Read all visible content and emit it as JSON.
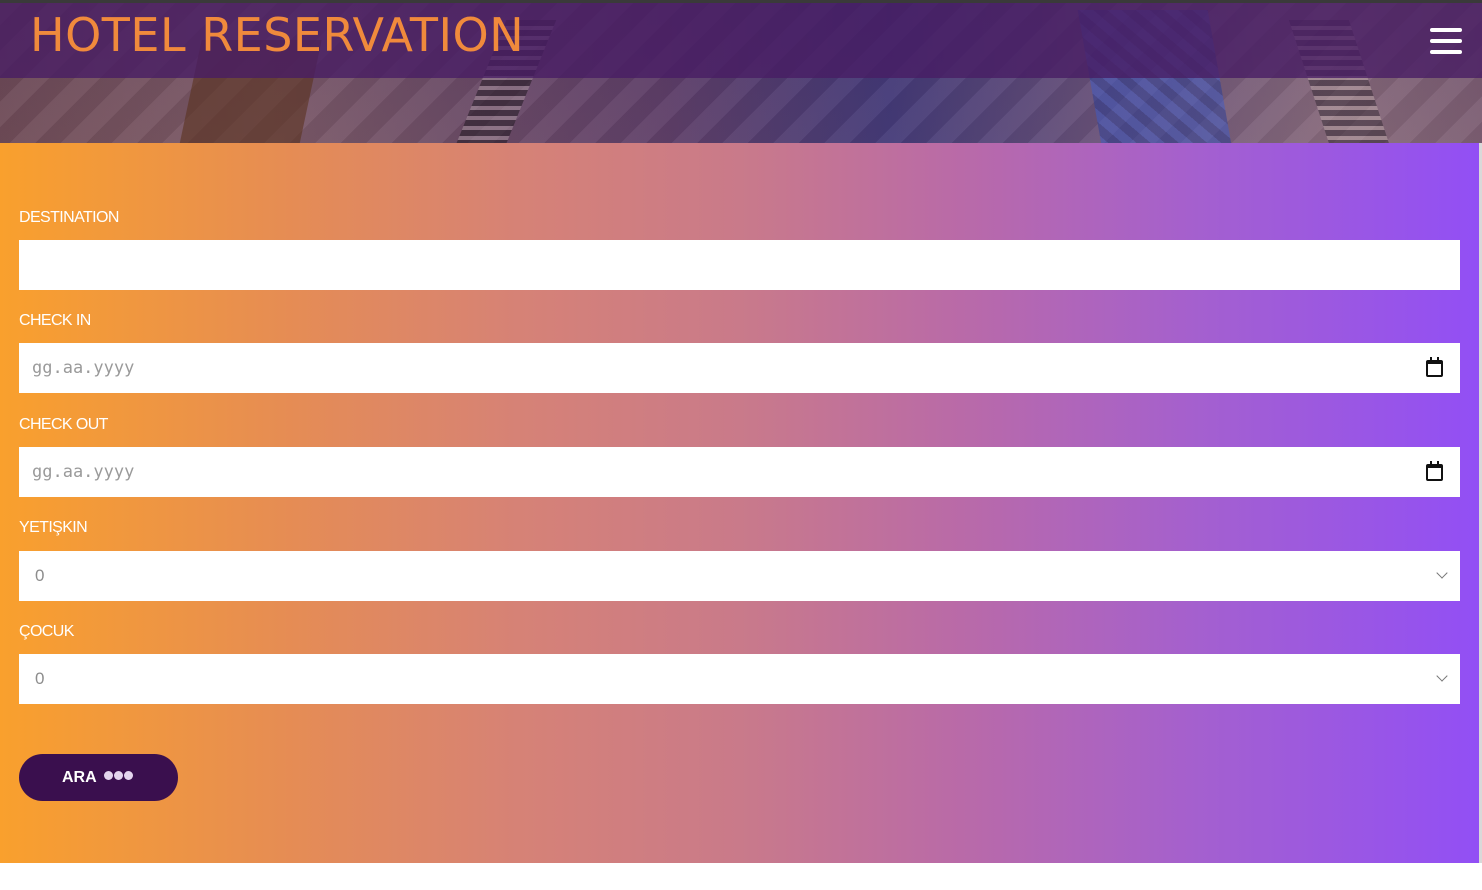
{
  "header": {
    "brand": "HOTEL RESERVATION",
    "menu_icon": "hamburger-menu-icon"
  },
  "form": {
    "destination": {
      "label": "DESTINATION",
      "value": ""
    },
    "check_in": {
      "label": "CHECK IN",
      "placeholder": "gg.aa.yyyy",
      "icon": "calendar-icon"
    },
    "check_out": {
      "label": "CHECK OUT",
      "placeholder": "gg.aa.yyyy",
      "icon": "calendar-icon"
    },
    "adults": {
      "label": "YETIŞKIN",
      "selected": "0"
    },
    "children": {
      "label": "ÇOCUK",
      "selected": "0"
    },
    "search_button": {
      "label": "ARA",
      "icon": "three-dots-icon"
    }
  },
  "colors": {
    "brand_text": "#f08a3c",
    "navbar": "#481c64",
    "gradient_start": "#f9a02d",
    "gradient_end": "#924ff5",
    "button": "#3a0f4e"
  }
}
